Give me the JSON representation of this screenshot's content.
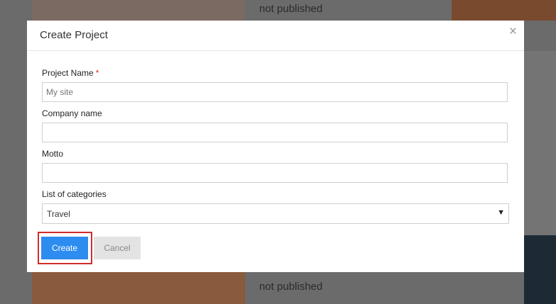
{
  "background": {
    "status_top": "not published",
    "status_bottom": "not published"
  },
  "modal": {
    "title": "Create Project",
    "close_icon": "close-icon",
    "fields": {
      "project_name": {
        "label": "Project Name",
        "required_mark": "*",
        "value": "",
        "placeholder": "My site"
      },
      "company_name": {
        "label": "Company name",
        "value": "",
        "placeholder": ""
      },
      "motto": {
        "label": "Motto",
        "value": "",
        "placeholder": ""
      },
      "categories": {
        "label": "List of categories",
        "selected": "Travel"
      }
    },
    "buttons": {
      "create": "Create",
      "cancel": "Cancel"
    }
  },
  "colors": {
    "primary": "#2d8cf0",
    "highlight": "#d22b2b",
    "required": "#d9342b"
  }
}
